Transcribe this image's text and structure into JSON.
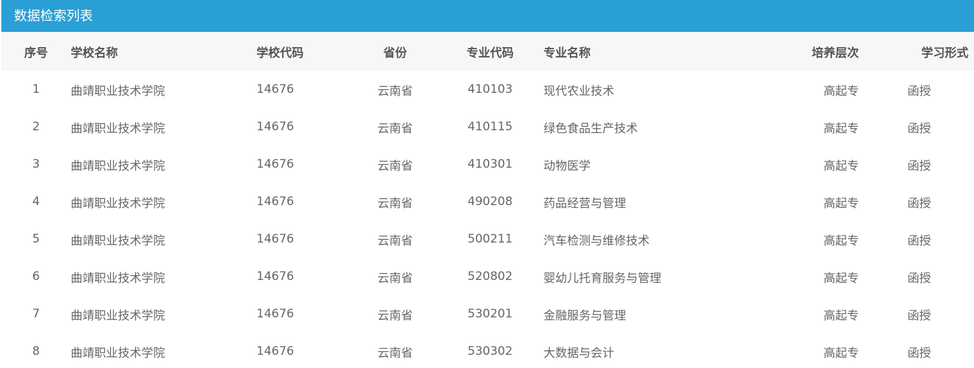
{
  "panel": {
    "title": "数据检索列表"
  },
  "table": {
    "headers": {
      "index": "序号",
      "school_name": "学校名称",
      "school_code": "学校代码",
      "province": "省份",
      "major_code": "专业代码",
      "major_name": "专业名称",
      "level": "培养层次",
      "study_mode": "学习形式"
    },
    "rows": [
      {
        "index": "1",
        "school_name": "曲靖职业技术学院",
        "school_code": "14676",
        "province": "云南省",
        "major_code": "410103",
        "major_name": "现代农业技术",
        "level": "高起专",
        "study_mode": "函授"
      },
      {
        "index": "2",
        "school_name": "曲靖职业技术学院",
        "school_code": "14676",
        "province": "云南省",
        "major_code": "410115",
        "major_name": "绿色食品生产技术",
        "level": "高起专",
        "study_mode": "函授"
      },
      {
        "index": "3",
        "school_name": "曲靖职业技术学院",
        "school_code": "14676",
        "province": "云南省",
        "major_code": "410301",
        "major_name": "动物医学",
        "level": "高起专",
        "study_mode": "函授"
      },
      {
        "index": "4",
        "school_name": "曲靖职业技术学院",
        "school_code": "14676",
        "province": "云南省",
        "major_code": "490208",
        "major_name": "药品经营与管理",
        "level": "高起专",
        "study_mode": "函授"
      },
      {
        "index": "5",
        "school_name": "曲靖职业技术学院",
        "school_code": "14676",
        "province": "云南省",
        "major_code": "500211",
        "major_name": "汽车检测与维修技术",
        "level": "高起专",
        "study_mode": "函授"
      },
      {
        "index": "6",
        "school_name": "曲靖职业技术学院",
        "school_code": "14676",
        "province": "云南省",
        "major_code": "520802",
        "major_name": "婴幼儿托育服务与管理",
        "level": "高起专",
        "study_mode": "函授"
      },
      {
        "index": "7",
        "school_name": "曲靖职业技术学院",
        "school_code": "14676",
        "province": "云南省",
        "major_code": "530201",
        "major_name": "金融服务与管理",
        "level": "高起专",
        "study_mode": "函授"
      },
      {
        "index": "8",
        "school_name": "曲靖职业技术学院",
        "school_code": "14676",
        "province": "云南省",
        "major_code": "530302",
        "major_name": "大数据与会计",
        "level": "高起专",
        "study_mode": "函授"
      }
    ]
  },
  "colors": {
    "header_bar": "#2a9fd6",
    "table_head_bg": "#f7f7f7"
  }
}
